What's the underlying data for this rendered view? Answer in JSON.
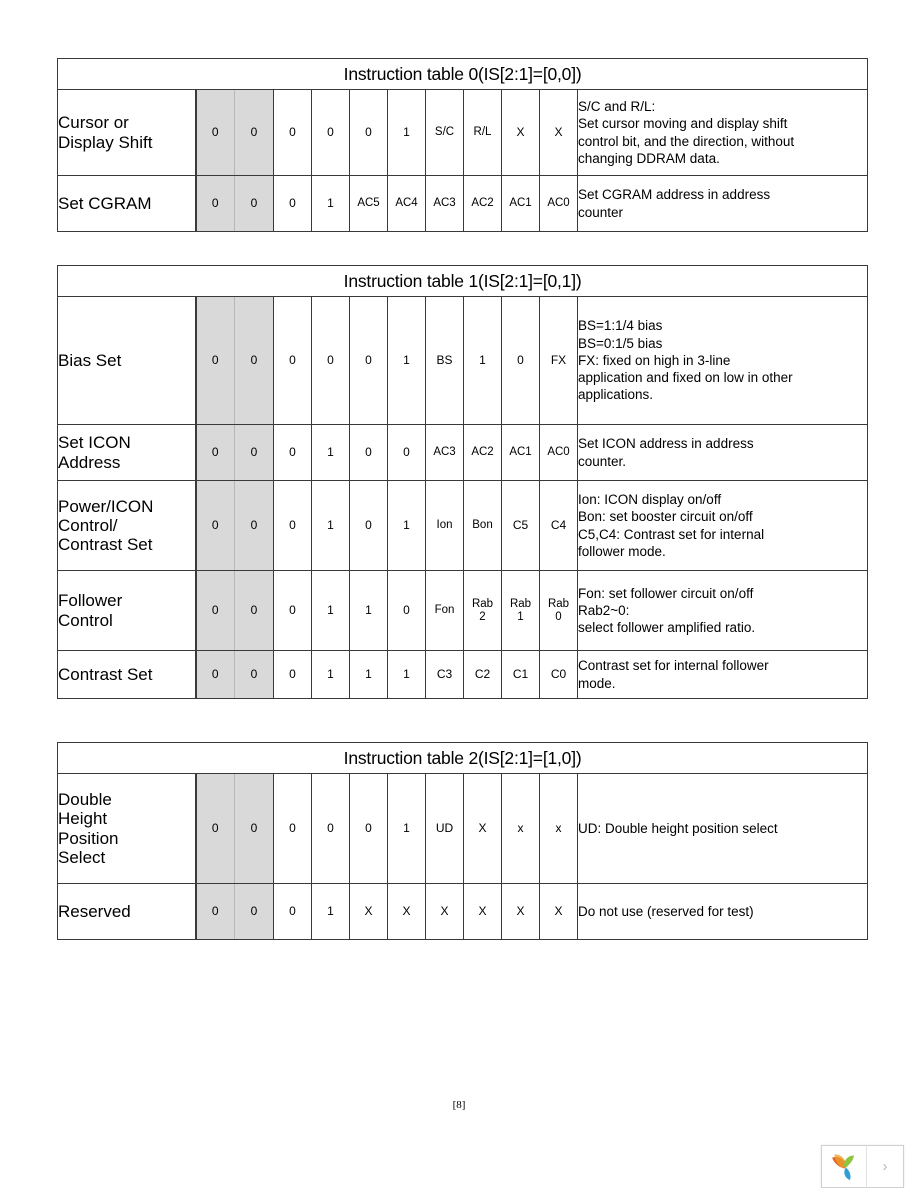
{
  "document": {
    "page_marker": "[8]"
  },
  "tables": [
    {
      "title": "Instruction table 0(IS[2:1]=[0,0])",
      "rows": [
        {
          "name": "Cursor or\nDisplay Shift",
          "bits": [
            "0",
            "0",
            "0",
            "0",
            "0",
            "1",
            "S/C",
            "R/L",
            "X",
            "X"
          ],
          "desc": "S/C and R/L:\nSet cursor moving and display shift\ncontrol bit, and the direction, without\nchanging DDRAM data."
        },
        {
          "name": "Set CGRAM",
          "bits": [
            "0",
            "0",
            "0",
            "1",
            "AC5",
            "AC4",
            "AC3",
            "AC2",
            "AC1",
            "AC0"
          ],
          "desc": "Set CGRAM address in address\ncounter"
        }
      ]
    },
    {
      "title": "Instruction table 1(IS[2:1]=[0,1])",
      "rows": [
        {
          "name": "Bias Set",
          "bits": [
            "0",
            "0",
            "0",
            "0",
            "0",
            "1",
            "BS",
            "1",
            "0",
            "FX"
          ],
          "desc": "BS=1:1/4 bias\nBS=0:1/5 bias\nFX: fixed on high in 3-line\napplication and fixed on low in other\napplications."
        },
        {
          "name": "Set ICON\nAddress",
          "bits": [
            "0",
            "0",
            "0",
            "1",
            "0",
            "0",
            "AC3",
            "AC2",
            "AC1",
            "AC0"
          ],
          "desc": "Set ICON address in address\ncounter."
        },
        {
          "name": "Power/ICON\nControl/\nContrast Set",
          "bits": [
            "0",
            "0",
            "0",
            "1",
            "0",
            "1",
            "Ion",
            "Bon",
            "C5",
            "C4"
          ],
          "desc": "Ion: ICON display on/off\nBon: set booster circuit on/off\nC5,C4: Contrast set for internal\nfollower mode."
        },
        {
          "name": "Follower\nControl",
          "bits": [
            "0",
            "0",
            "0",
            "1",
            "1",
            "0",
            "Fon",
            "Rab\n2",
            "Rab\n1",
            "Rab\n0"
          ],
          "desc": "Fon: set follower circuit on/off\nRab2~0:\nselect follower amplified ratio."
        },
        {
          "name": "Contrast Set",
          "bits": [
            "0",
            "0",
            "0",
            "1",
            "1",
            "1",
            "C3",
            "C2",
            "C1",
            "C0"
          ],
          "desc": "Contrast set for internal follower\nmode."
        }
      ]
    },
    {
      "title": "Instruction table 2(IS[2:1]=[1,0])",
      "rows": [
        {
          "name": "Double\nHeight\nPosition\nSelect",
          "bits": [
            "0",
            "0",
            "0",
            "0",
            "0",
            "1",
            "UD",
            "X",
            "x",
            "x"
          ],
          "desc": "UD: Double height position select"
        },
        {
          "name": "Reserved",
          "bits": [
            "0",
            "0",
            "0",
            "1",
            "X",
            "X",
            "X",
            "X",
            "X",
            "X"
          ],
          "desc": "Do not use (reserved for test)"
        }
      ]
    }
  ],
  "widget": {
    "logo_name": "leaf-logo",
    "next_label": "›",
    "colors": {
      "petal_orange": "#e8642a",
      "petal_green": "#8cc63f",
      "petal_blue": "#2e9fd6"
    }
  }
}
